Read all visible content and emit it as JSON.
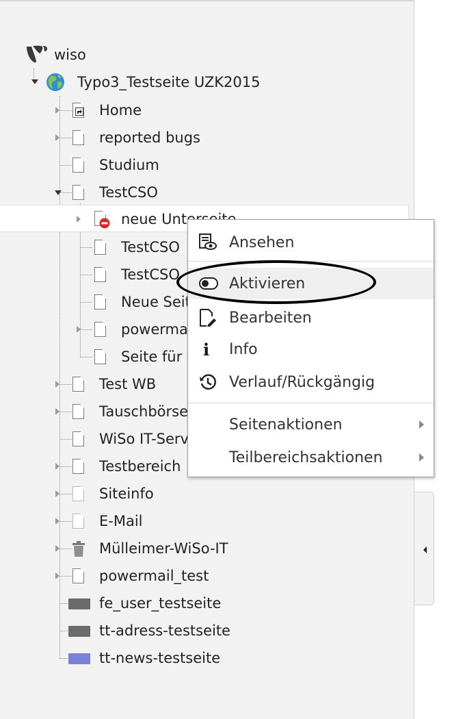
{
  "tree": {
    "root_label": "wiso",
    "site_label": "Typo3_Testseite UZK2015",
    "nodes": {
      "home": "Home",
      "reported_bugs": "reported bugs",
      "studium": "Studium",
      "testcso": "TestCSO",
      "neue_unterseite": "neue Unterseite",
      "testcso_child1": "TestCSO",
      "testcso_child2": "TestCSO",
      "neue_seite": "Neue Seite",
      "powermail": "powermail",
      "seite_fuer": "Seite für",
      "test_wb": "Test WB",
      "tauschboerse": "Tauschbörse",
      "wiso_it_service": "WiSo IT-Service",
      "testbereich": "Testbereich",
      "siteinfo": "Siteinfo",
      "email": "E-Mail",
      "muelleimer": "Mülleimer-WiSo-IT",
      "powermail_test": "powermail_test",
      "fe_user_testseite": "fe_user_testseite",
      "tt_adress_testseite": "tt-adress-testseite",
      "tt_news_testseite": "tt-news-testseite"
    }
  },
  "context_menu": {
    "ansehen": "Ansehen",
    "aktivieren": "Aktivieren",
    "bearbeiten": "Bearbeiten",
    "info": "Info",
    "verlauf": "Verlauf/Rückgängig",
    "seitenaktionen": "Seitenaktionen",
    "teilbereichsaktionen": "Teilbereichsaktionen"
  },
  "icons": {
    "root": "typo3-logo-icon",
    "site": "globe-icon",
    "page": "page-icon",
    "shortcut": "shortcut-page-icon",
    "hidden_page": "hidden-page-icon",
    "trash": "trash-icon",
    "folder": "folder-icon"
  },
  "colors": {
    "panel_bg": "#f2f2f2",
    "hover_bg": "#efefef",
    "hidden_badge": "#d62828",
    "folder_dark": "#6b6b6b",
    "folder_news": "#7a7fd8",
    "globe_blue": "#2f8fd6",
    "globe_green": "#8bc34a"
  }
}
